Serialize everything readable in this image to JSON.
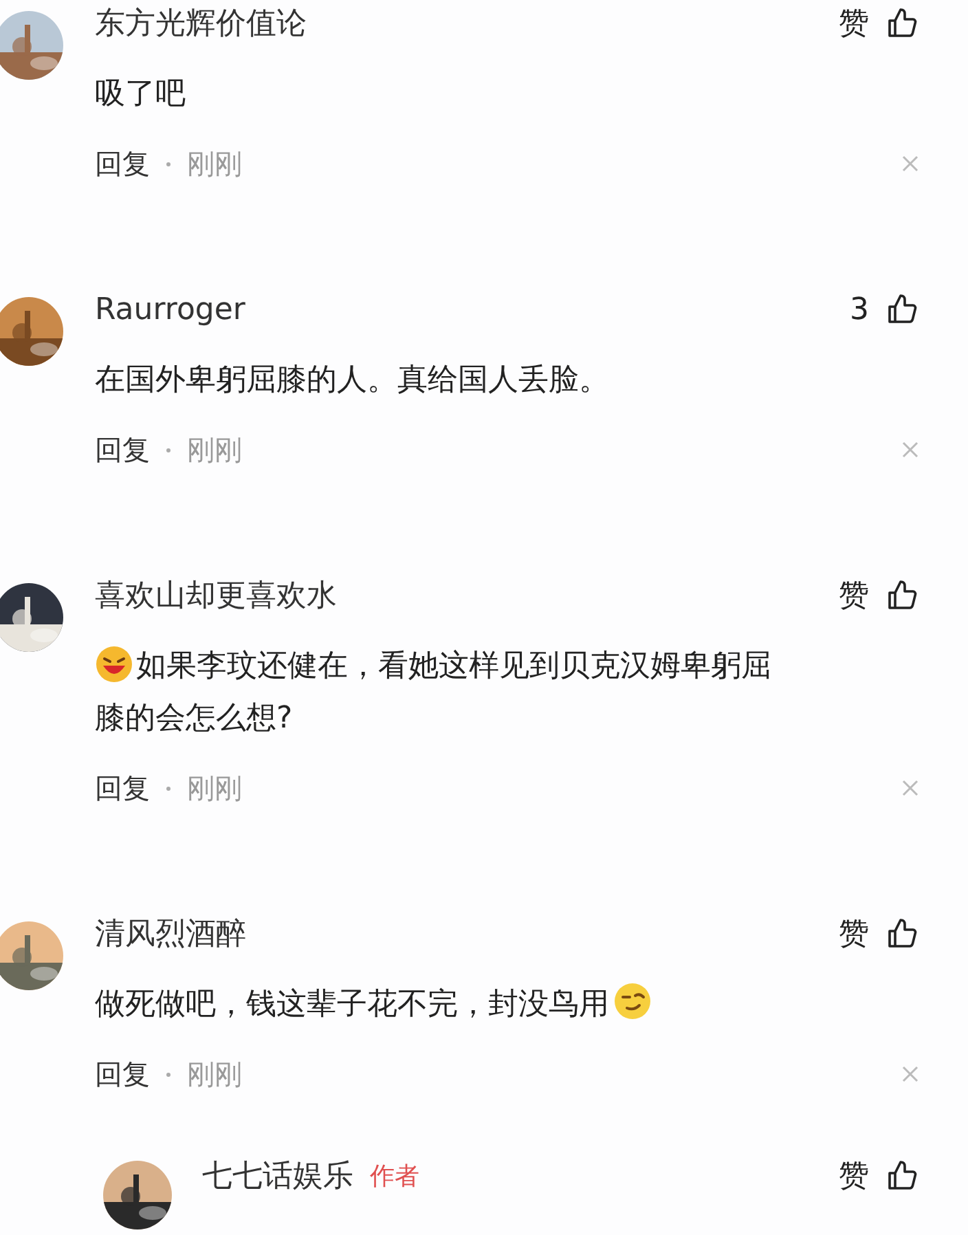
{
  "comments": [
    {
      "name": "东方光辉价值论",
      "like": "赞",
      "body": "吸了吧",
      "reply": "回复",
      "time": "刚刚"
    },
    {
      "name": "Raurroger",
      "like": "3",
      "body": "在国外卑躬屈膝的人。真给国人丢脸。",
      "reply": "回复",
      "time": "刚刚"
    },
    {
      "name": "喜欢山却更喜欢水",
      "like": "赞",
      "kind": "emoji-first",
      "body": "如果李玟还健在，看她这样见到贝克汉姆卑躬屈膝的会怎么想?",
      "reply": "回复",
      "time": "刚刚"
    },
    {
      "name": "清风烈酒醉",
      "like": "赞",
      "body": "做死做吧，钱这辈子花不完，封没鸟用",
      "kind": "emoji-last",
      "reply": "回复",
      "time": "刚刚"
    }
  ],
  "reply_item": {
    "name": "七七话娱乐",
    "tag": "作者",
    "like": "赞"
  }
}
